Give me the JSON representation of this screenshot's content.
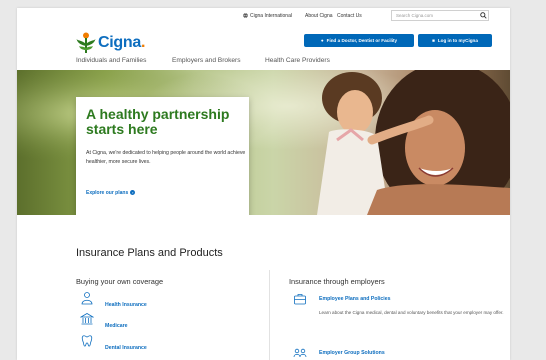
{
  "utility_bar": {
    "links": [
      "Cigna International",
      "About Cigna",
      "Contact Us"
    ],
    "search_placeholder": "Search Cigna.com"
  },
  "brand": {
    "name": "Cigna",
    "colors": {
      "blue": "#0e6ebf",
      "green": "#2d7a1f",
      "orange": "#f07c00"
    }
  },
  "header_buttons": {
    "find_doctor": "Find a Doctor, Dentist or Facility",
    "login": "Log in to myCigna"
  },
  "nav": {
    "items": [
      "Individuals and Families",
      "Employers and Brokers",
      "Health Care Providers"
    ]
  },
  "hero": {
    "title": "A healthy partnership starts here",
    "text": "At Cigna, we're dedicated to helping people around the world achieve healthier, more secure lives.",
    "link": "Explore our plans"
  },
  "products": {
    "title": "Insurance Plans and Products",
    "left": {
      "title": "Buying your own coverage",
      "items": [
        "Health Insurance",
        "Medicare",
        "Dental Insurance"
      ]
    },
    "right": {
      "title": "Insurance through employers",
      "items": [
        {
          "label": "Employee Plans and Policies",
          "desc": "Learn about the Cigna medical, dental and voluntary benefits that your employer may offer."
        },
        {
          "label": "Employer Group Solutions",
          "desc": ""
        }
      ]
    }
  },
  "icons": [
    "globe-icon",
    "search-icon",
    "cigna-tree-logo",
    "location-pin-icon",
    "lock-icon",
    "health-person-icon",
    "medicare-building-icon",
    "tooth-icon",
    "briefcase-icon",
    "group-people-icon"
  ]
}
